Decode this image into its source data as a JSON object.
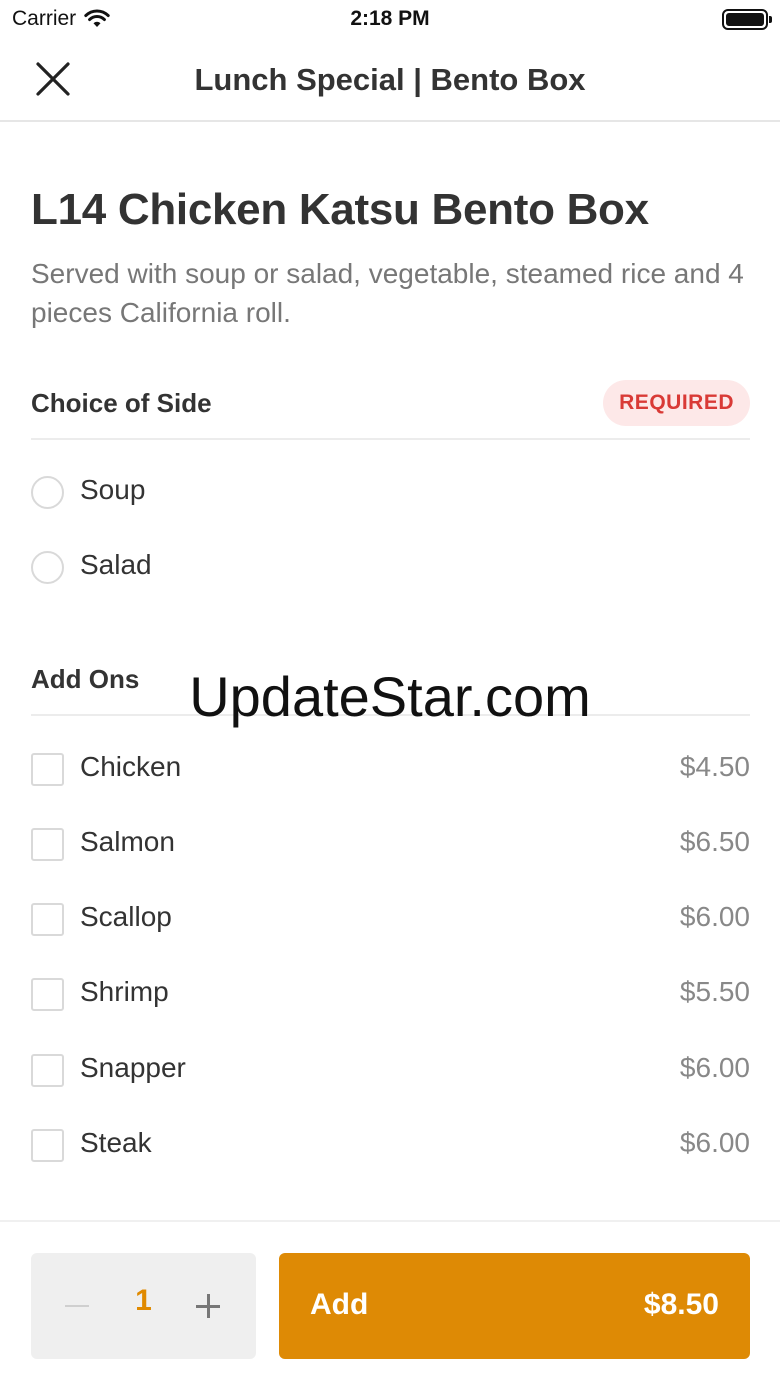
{
  "status_bar": {
    "carrier": "Carrier",
    "time": "2:18 PM"
  },
  "nav": {
    "title": "Lunch Special | Bento Box"
  },
  "item": {
    "title": "L14 Chicken Katsu Bento Box",
    "description": "Served with soup or salad, vegetable, steamed rice and 4 pieces California roll."
  },
  "side_section": {
    "title": "Choice of Side",
    "badge": "REQUIRED",
    "options": [
      {
        "label": "Soup"
      },
      {
        "label": "Salad"
      }
    ]
  },
  "addons_section": {
    "title": "Add Ons",
    "options": [
      {
        "label": "Chicken",
        "price": "$4.50"
      },
      {
        "label": "Salmon",
        "price": "$6.50"
      },
      {
        "label": "Scallop",
        "price": "$6.00"
      },
      {
        "label": "Shrimp",
        "price": "$5.50"
      },
      {
        "label": "Snapper",
        "price": "$6.00"
      },
      {
        "label": "Steak",
        "price": "$6.00"
      }
    ]
  },
  "watermark": "UpdateStar.com",
  "footer": {
    "quantity": "1",
    "add_label": "Add",
    "add_price": "$8.50"
  },
  "colors": {
    "accent": "#de8a05",
    "quantity_text": "#e08a00",
    "required_text": "#d93a36",
    "required_bg": "#fde8e8"
  }
}
